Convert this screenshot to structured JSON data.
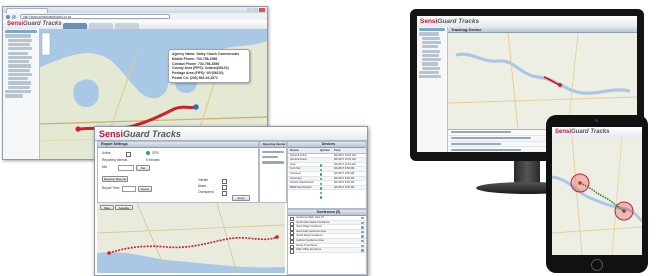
{
  "desktop_window": {
    "address": "http://www.sensiguardtracks.co.za",
    "brand_red": "Sensi",
    "brand_gray": "Guard Tracks",
    "info_popup_lines": [
      "Agency Name: Daisy Coach Commercials",
      "Mobile Phone: 730-798-3556",
      "Contact Phone: 730-798-3556",
      "County Area (FIPS): Ontario(95120)",
      "Postage Area (FIPS): WV(56120)",
      "Postal Cd: (200) 563-34-4571"
    ]
  },
  "laptop_window": {
    "brand_red": "Sensi",
    "brand_gray": "Guard Tracks",
    "report_title": "Report Settings",
    "reporting_interval_title": "Reporting Interval (fl)",
    "devices_title": "Devices",
    "geofences_title": "Geofences (5)",
    "labels": {
      "active": "Active",
      "min": "Min",
      "interval": "Reporting Interval",
      "gps_label": "GPS",
      "interval_value": "5 minutes",
      "request_reports": "Request Reports",
      "set": "Set",
      "state": "Reset",
      "apply": "Apply",
      "report_time": "Report Time",
      "vibrate": "Vibrate",
      "alarm": "Alarm",
      "overspeed": "Overspeed"
    },
    "device_columns": [
      "Device",
      "Ignition",
      "Time"
    ],
    "devices": [
      {
        "name": "General Active",
        "time": "9/1/2017 10:02 AM"
      },
      {
        "name": "General Active",
        "time": "9/1/2017 10:01 AM"
      },
      {
        "name": "Jeep",
        "time": "9/1/2017 10:00 AM"
      },
      {
        "name": "Ford Van",
        "time": "9/1/2017 9:58 AM"
      },
      {
        "name": "Conveyor",
        "time": "9/1/2017 9:55 AM"
      },
      {
        "name": "Generator",
        "time": "9/1/2017 9:50 AM"
      },
      {
        "name": "Vehicle Switchboard",
        "time": "9/1/2017 9:45 AM"
      },
      {
        "name": "BMW Switchboard",
        "time": "9/1/2017 9:40 AM"
      }
    ],
    "geofences": [
      "Geofence Main Gate 01",
      "North Park Station Geofence",
      "West Ridge Geofence",
      "East Gate Geofence Area",
      "South Depot Geofence",
      "Harbour Geofence Area",
      "Route 5 Geofence",
      "Main Office Geofence"
    ],
    "map_tabs": [
      "Map",
      "Satellite"
    ]
  },
  "monitor_window": {
    "brand_red": "Sensi",
    "brand_gray": "Guard Tracks",
    "panel_title": "Tracking Device"
  },
  "tablet_window": {
    "brand_red": "Sensi",
    "brand_gray": "Guard Tracks"
  },
  "colors": {
    "brand_red": "#c8102e",
    "track_red": "#d21f2a",
    "map_water": "#a9c8e6",
    "map_land": "#e6ebd8"
  }
}
